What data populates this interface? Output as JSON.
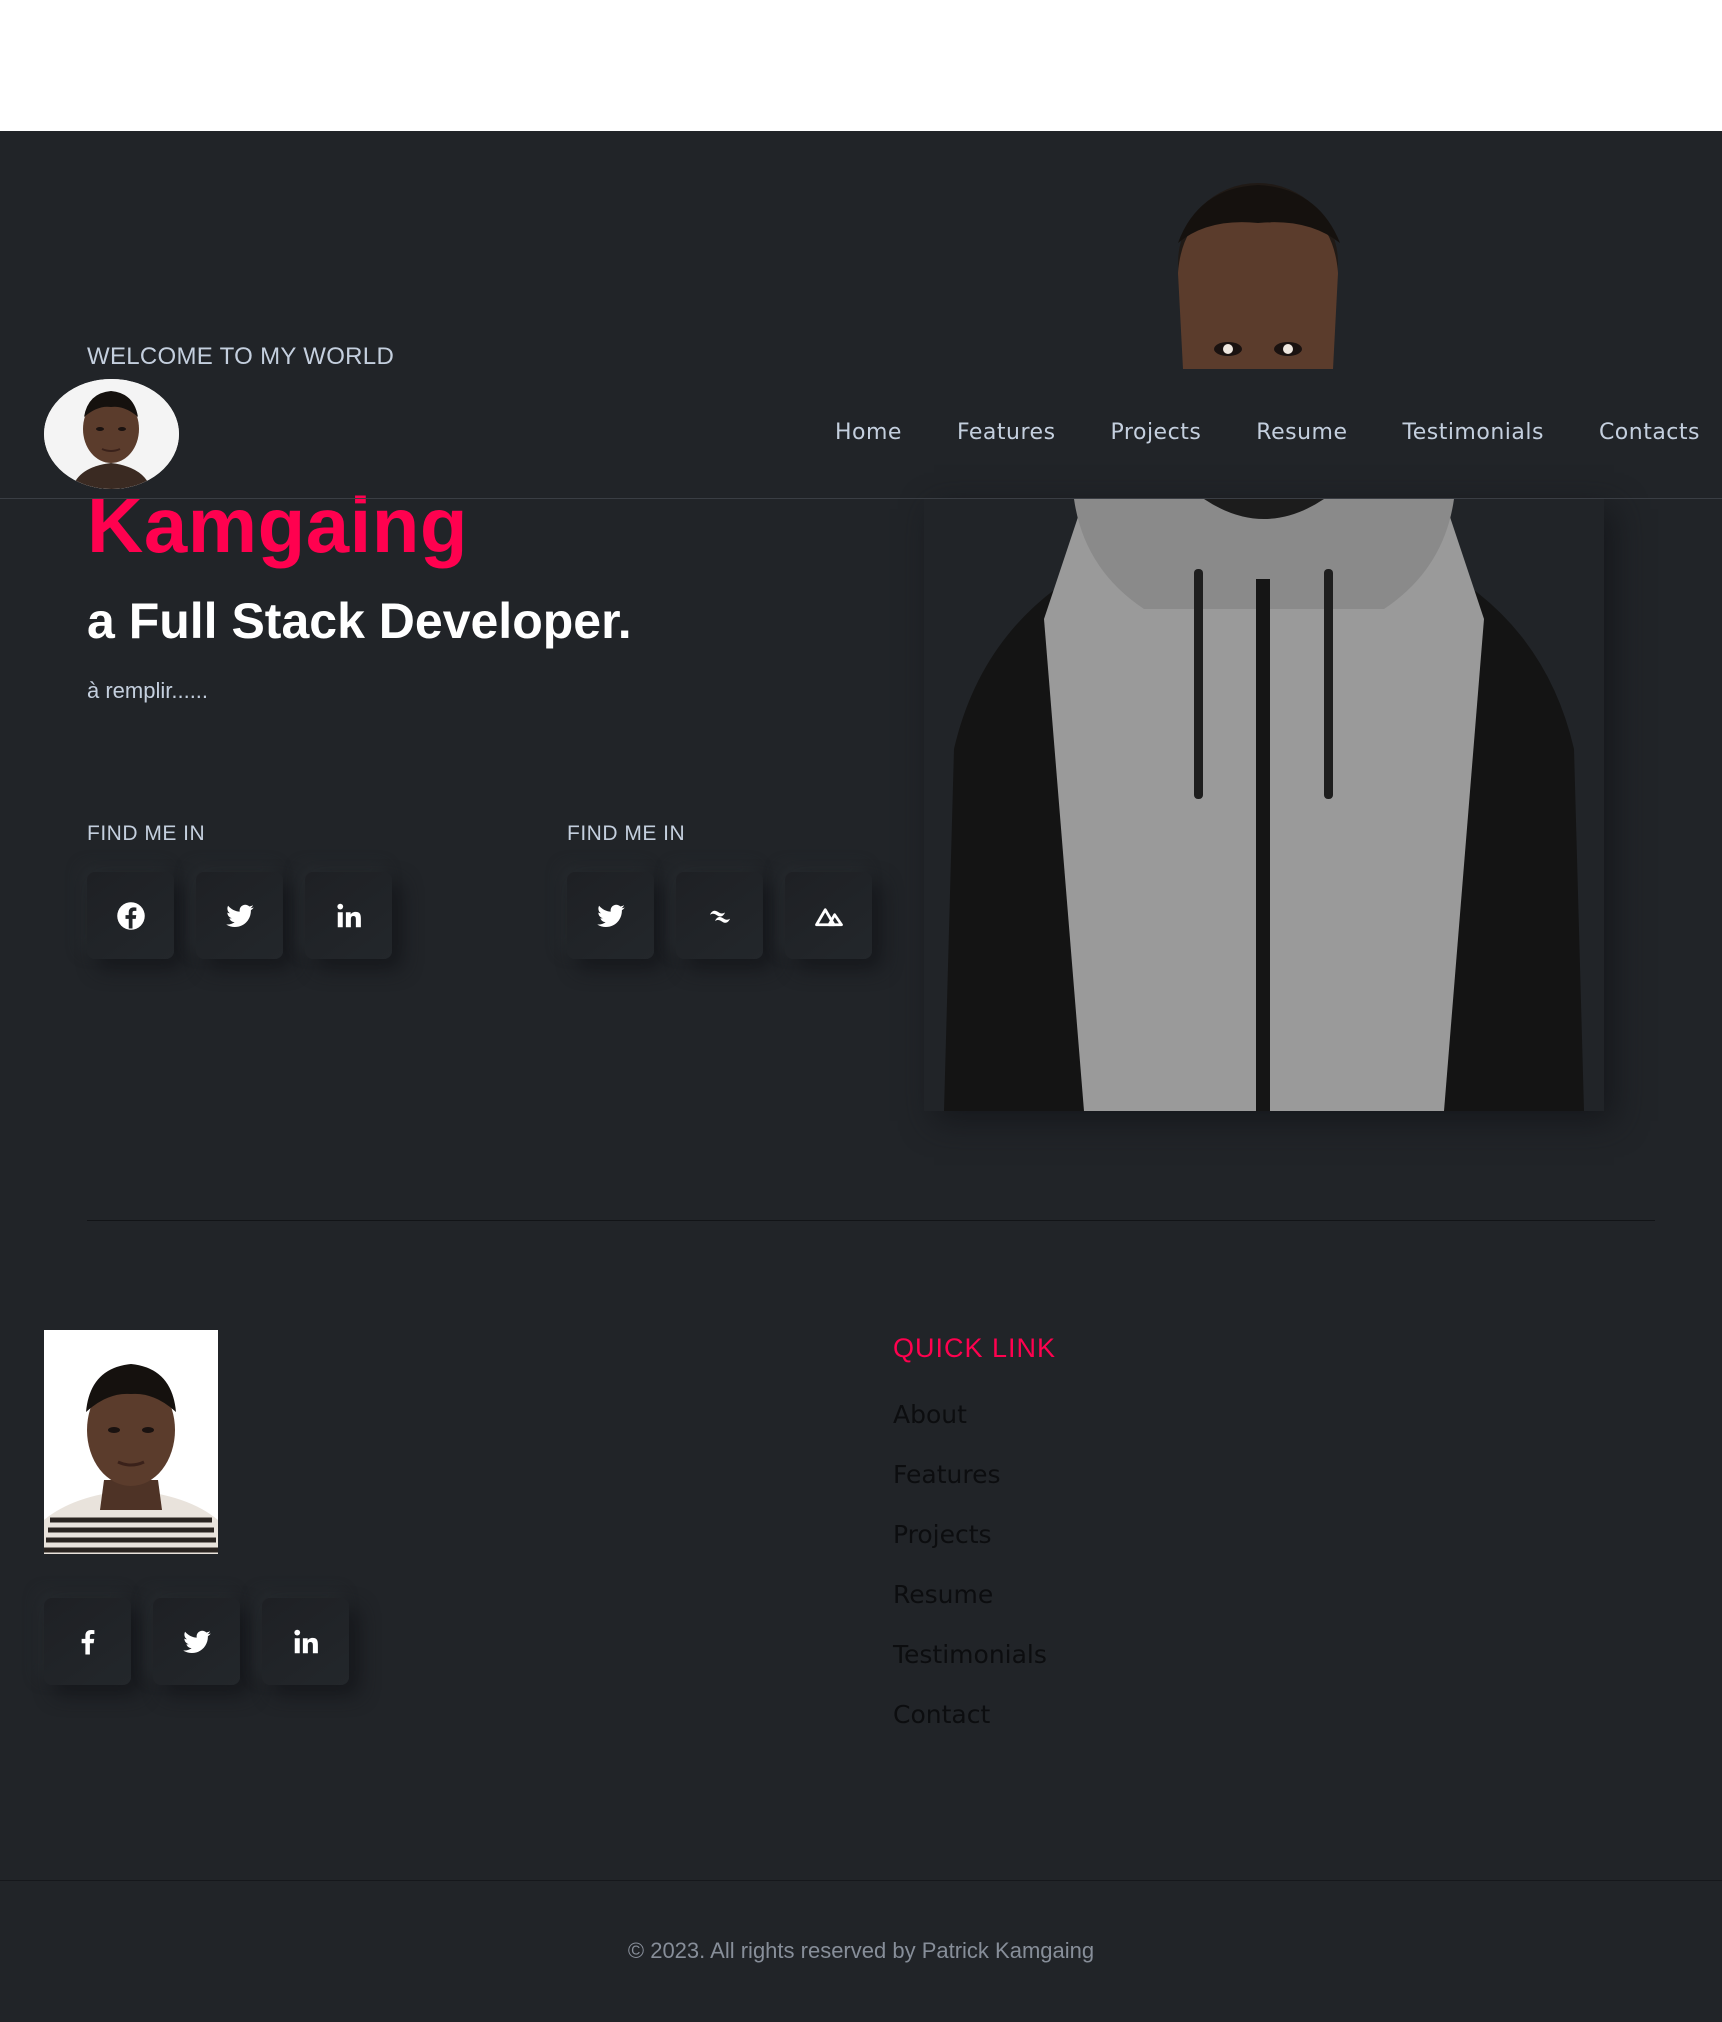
{
  "header": {
    "logo_alt": "Profile avatar",
    "nav": [
      {
        "label": "Home"
      },
      {
        "label": "Features"
      },
      {
        "label": "Projects"
      },
      {
        "label": "Resume"
      },
      {
        "label": "Testimonials"
      },
      {
        "label": "Contacts"
      }
    ]
  },
  "hero": {
    "welcome": "WELCOME TO MY WORLD",
    "name": "Kamgaing",
    "role": "a Full Stack Developer.",
    "description": "à remplir......",
    "find_me_a": "FIND ME IN",
    "find_me_b": "FIND ME IN",
    "social_a": [
      "facebook-icon",
      "twitter-icon",
      "linkedin-icon"
    ],
    "social_b": [
      "twitter-icon",
      "tailwind-icon",
      "nuxt-icon"
    ]
  },
  "footer": {
    "quick_title": "QUICK LINK",
    "links": [
      {
        "label": "About"
      },
      {
        "label": "Features"
      },
      {
        "label": "Projects"
      },
      {
        "label": "Resume"
      },
      {
        "label": "Testimonials"
      },
      {
        "label": "Contact"
      }
    ],
    "social": [
      "facebook-f-icon",
      "twitter-icon",
      "linkedin-icon"
    ],
    "copyright": "© 2023. All rights reserved by Patrick Kamgaing"
  },
  "colors": {
    "background": "#212428",
    "accent": "#ff014f",
    "text": "#c4cfde"
  }
}
